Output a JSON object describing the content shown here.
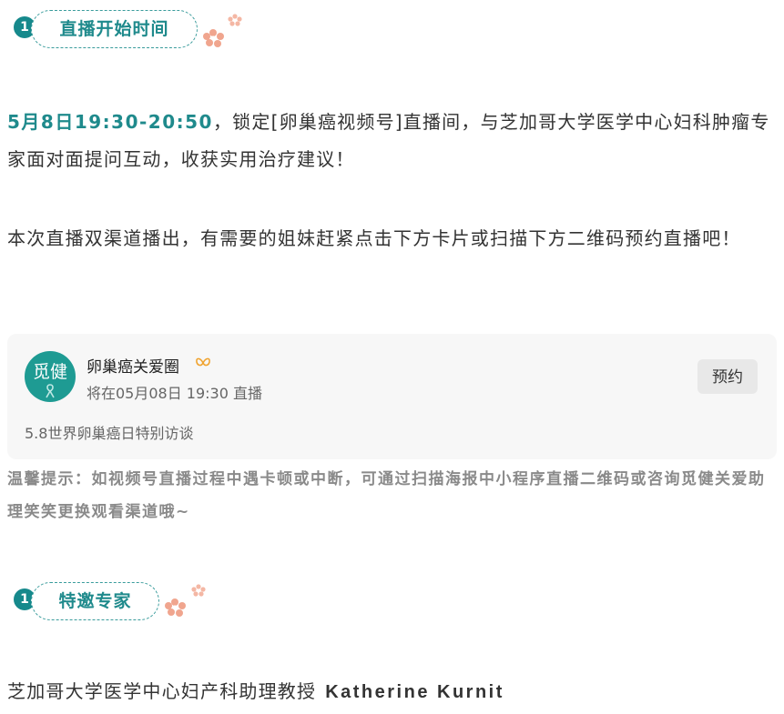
{
  "section1": {
    "number": "1",
    "title": "直播开始时间"
  },
  "intro": {
    "highlight": "5月8日19:30-20:50",
    "text": "，锁定[卵巢癌视频号]直播间，与芝加哥大学医学中心妇科肿瘤专家面对面提问互动，收获实用治疗建议！"
  },
  "channels": {
    "text": "本次直播双渠道播出，有需要的姐妹赶紧点击下方卡片或扫描下方二维码预约直播吧！"
  },
  "card": {
    "avatar_text": "觅健",
    "account_name": "卵巢癌关爱圈",
    "schedule": "将在05月08日 19:30 直播",
    "book_label": "预约",
    "subtitle": "5.8世界卵巢癌日特别访谈"
  },
  "tip": {
    "text": "温馨提示：如视频号直播过程中遇卡顿或中断，可通过扫描海报中小程序直播二维码或咨询觅健关爱助理笑笑更换观看渠道哦~"
  },
  "section2": {
    "number": "1",
    "title": "特邀专家"
  },
  "expert": {
    "title": "芝加哥大学医学中心妇产科助理教授",
    "name": "Katherine Kurnit"
  },
  "colors": {
    "accent": "#1f8a8c",
    "flower": "#f0a58e",
    "card_bg": "#f7f7f7"
  }
}
